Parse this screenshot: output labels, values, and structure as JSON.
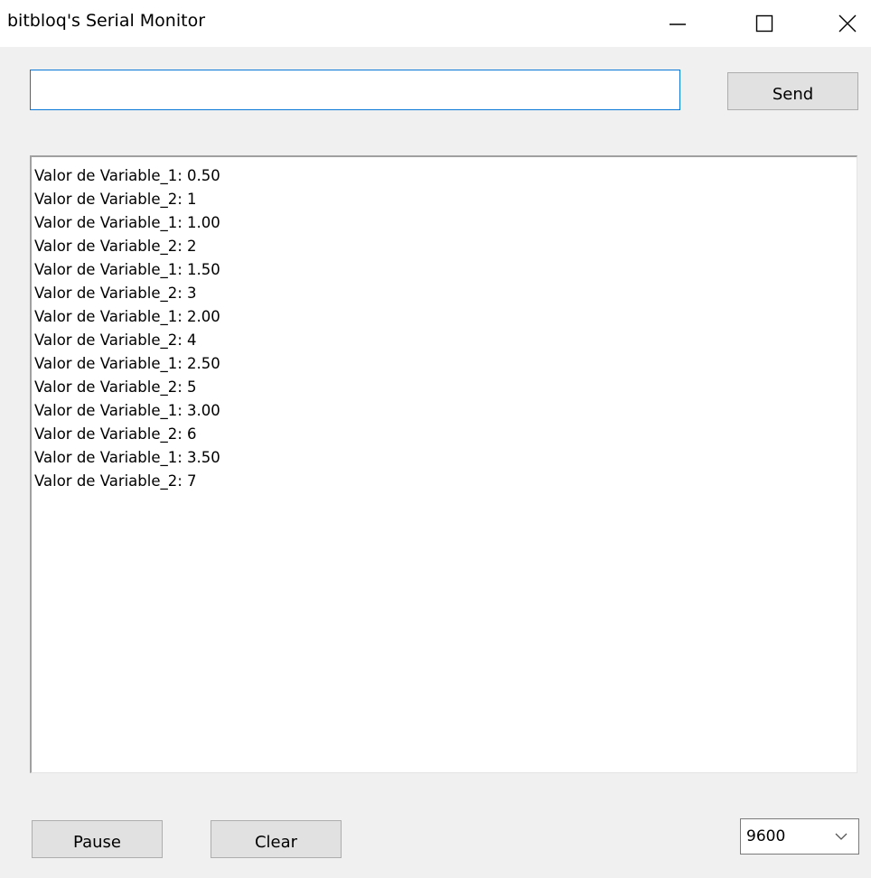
{
  "window": {
    "title": "bitbloq's Serial Monitor"
  },
  "send": {
    "input_value": "",
    "button_label": "Send"
  },
  "output": {
    "lines": [
      "Valor de Variable_1: 0.50",
      "Valor de Variable_2: 1",
      "Valor de Variable_1: 1.00",
      "Valor de Variable_2: 2",
      "Valor de Variable_1: 1.50",
      "Valor de Variable_2: 3",
      "Valor de Variable_1: 2.00",
      "Valor de Variable_2: 4",
      "Valor de Variable_1: 2.50",
      "Valor de Variable_2: 5",
      "Valor de Variable_1: 3.00",
      "Valor de Variable_2: 6",
      "Valor de Variable_1: 3.50",
      "Valor de Variable_2: 7"
    ]
  },
  "controls": {
    "pause_label": "Pause",
    "clear_label": "Clear",
    "baud_rate": "9600"
  },
  "icons": {
    "minimize": "minimize-icon",
    "maximize": "maximize-icon",
    "close": "close-icon",
    "dropdown": "chevron-down-icon"
  },
  "colors": {
    "input_focus_border": "#0a78d7",
    "button_face": "#e1e1e1",
    "window_background": "#f0f0f0"
  }
}
